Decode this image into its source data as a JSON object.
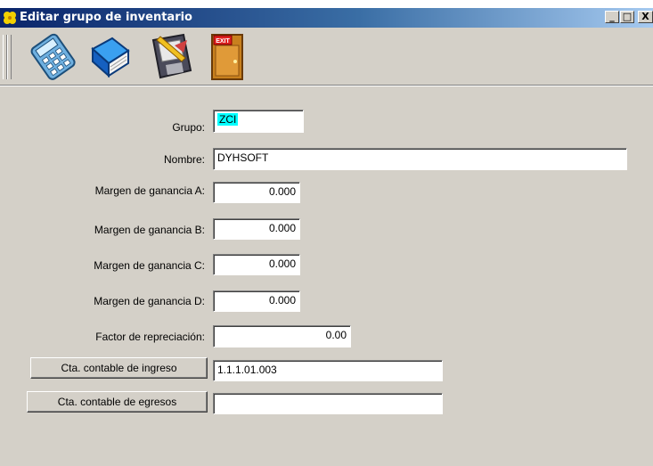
{
  "window": {
    "title": "Editar grupo de inventario",
    "minimize_glyph": "_",
    "maximize_glyph": "□",
    "close_glyph": "X"
  },
  "toolbar": {
    "tools": [
      {
        "icon": "calculator-icon"
      },
      {
        "icon": "book-icon"
      },
      {
        "icon": "save-disk-icon"
      },
      {
        "icon": "exit-door-icon",
        "text": "EXIT"
      }
    ]
  },
  "form": {
    "grupo_label": "Grupo:",
    "grupo_value": "ZCI",
    "nombre_label": "Nombre:",
    "nombre_value": "DYHSOFT",
    "margen_a_label": "Margen de ganancia A:",
    "margen_a_value": "0.000",
    "margen_b_label": "Margen de ganancia B:",
    "margen_b_value": "0.000",
    "margen_c_label": "Margen de ganancia C:",
    "margen_c_value": "0.000",
    "margen_d_label": "Margen de ganancia D:",
    "margen_d_value": "0.000",
    "factor_label": "Factor de repreciación:",
    "factor_value": "0.00",
    "cta_ingreso_button": "Cta. contable de ingreso",
    "cta_ingreso_value": "1.1.1.01.003",
    "cta_egresos_button": "Cta. contable de egresos",
    "cta_egresos_value": ""
  }
}
